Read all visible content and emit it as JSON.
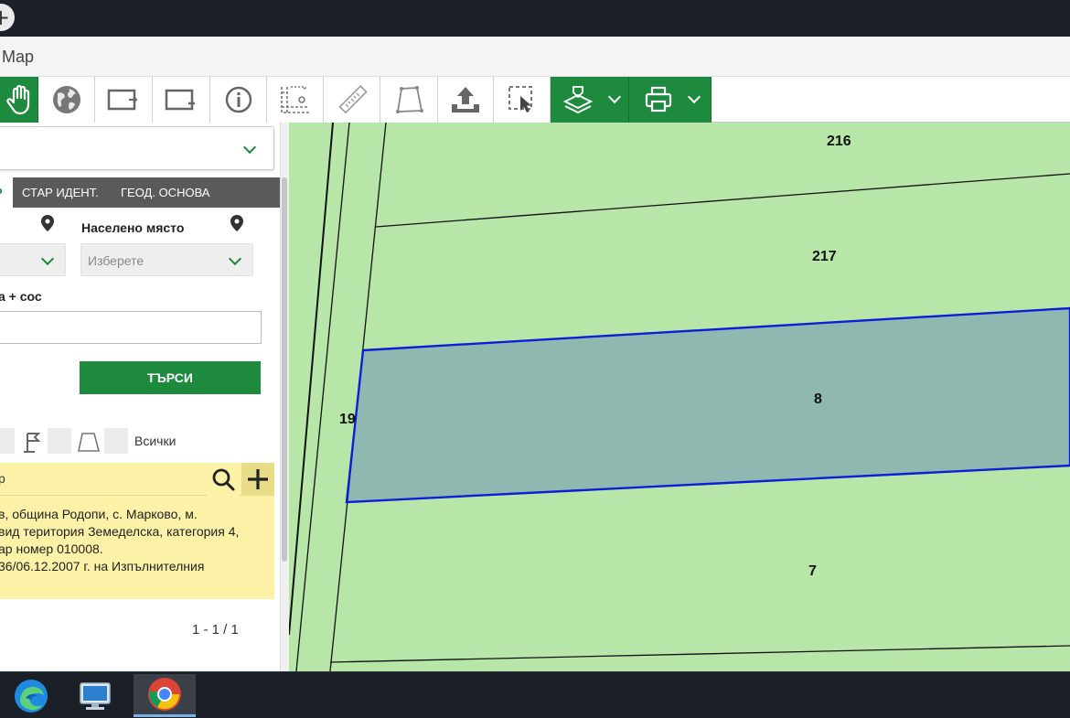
{
  "window": {
    "title": "Map"
  },
  "toolbar": {
    "buttons": [
      {
        "name": "pan-tool-button",
        "icon": "hand-icon",
        "active": true
      },
      {
        "name": "globe-button",
        "icon": "globe-icon"
      },
      {
        "name": "zoom-in-box-button",
        "icon": "zoom-box-in-icon"
      },
      {
        "name": "zoom-out-box-button",
        "icon": "zoom-box-out-icon"
      },
      {
        "name": "info-button",
        "icon": "info-icon"
      },
      {
        "name": "coordinates-button",
        "icon": "coordinates-icon"
      },
      {
        "name": "measure-distance-button",
        "icon": "ruler-icon"
      },
      {
        "name": "measure-area-button",
        "icon": "polygon-icon"
      },
      {
        "name": "upload-button",
        "icon": "upload-icon"
      },
      {
        "name": "select-area-button",
        "icon": "select-cursor-icon"
      },
      {
        "name": "layers-button",
        "icon": "layers-icon",
        "active": true,
        "dropdown": true
      },
      {
        "name": "print-button",
        "icon": "printer-icon",
        "active": true,
        "dropdown": true
      }
    ]
  },
  "sidebar": {
    "tabs": {
      "active_suffix": "Р",
      "old_ident": "СТАР ИДЕНТ.",
      "geod_basis": "ГЕОД. ОСНОВА"
    },
    "settlement_label": "Населено място",
    "settlement_placeholder": "Изберете",
    "field_label_partial": "а + сос",
    "search_button": "ТЪРСИ",
    "filter_all": "Всички",
    "result_search_partial": "р",
    "result_lines": [
      "в, община Родопи, с. Марково, м.",
      "вид територия Земеделска, категория 4,",
      "ар номер 010008.",
      "36/06.12.2007 г. на Изпълнителния"
    ],
    "pager": "1 - 1 / 1"
  },
  "map": {
    "parcels": [
      {
        "label": "216"
      },
      {
        "label": "217"
      },
      {
        "label": "8",
        "selected": true
      },
      {
        "label": "19"
      },
      {
        "label": "7"
      }
    ],
    "colors": {
      "parcel_fill": "#b8e6a8",
      "selected_fill": "#8fb8b0",
      "selected_stroke": "#0a1fd6"
    }
  },
  "taskbar": {
    "apps": [
      {
        "name": "edge",
        "icon": "edge-icon"
      },
      {
        "name": "remote-desktop",
        "icon": "computer-icon"
      },
      {
        "name": "chrome",
        "icon": "chrome-icon",
        "active": true
      }
    ]
  },
  "colors": {
    "accent": "#1d8a3e",
    "highlight": "#fbf2a8",
    "tab_bar": "#5a5a5a"
  }
}
